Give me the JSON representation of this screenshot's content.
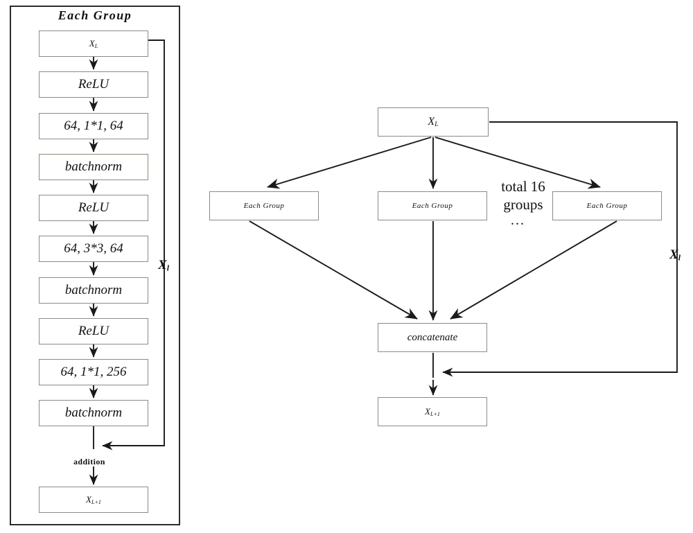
{
  "figure": {
    "title": "Each Group",
    "left_panel": {
      "title": "Each Group",
      "residual_label": "X",
      "residual_label_sub": "l",
      "addition_label": "addition",
      "nodes": [
        {
          "id": "x_l_in",
          "text": "X",
          "sub": "L",
          "style": "plain"
        },
        {
          "id": "relu_1",
          "text": "ReLU",
          "sub": "",
          "style": "plain"
        },
        {
          "id": "conv_1",
          "text": "64, 1*1, 64",
          "sub": "",
          "style": "plain"
        },
        {
          "id": "bn_1",
          "text": "batchnorm",
          "sub": "",
          "style": "tan"
        },
        {
          "id": "relu_2",
          "text": "ReLU",
          "sub": "",
          "style": "plain"
        },
        {
          "id": "conv_2",
          "text": "64, 3*3, 64",
          "sub": "",
          "style": "plain"
        },
        {
          "id": "bn_2",
          "text": "batchnorm",
          "sub": "",
          "style": "plain"
        },
        {
          "id": "relu_3",
          "text": "ReLU",
          "sub": "",
          "style": "plain"
        },
        {
          "id": "conv_3",
          "text": "64, 1*1, 256",
          "sub": "",
          "style": "plain"
        },
        {
          "id": "bn_3",
          "text": "batchnorm",
          "sub": "",
          "style": "plain"
        },
        {
          "id": "x_l_out",
          "text": "X",
          "sub": "L+1",
          "style": "plain"
        }
      ]
    },
    "right_panel": {
      "input_box": {
        "text": "X",
        "sub": "L"
      },
      "group_boxes": [
        {
          "text": "Each Group"
        },
        {
          "text": "Each Group"
        },
        {
          "text": "Each Group"
        }
      ],
      "total_line_1": "total 16",
      "total_line_2": "groups",
      "ellipsis": "...",
      "concat_box": {
        "text": "concatenate"
      },
      "output_box": {
        "text": "X",
        "sub": "L+1"
      },
      "residual_label": "X",
      "residual_label_sub": "l"
    }
  },
  "colors": {
    "panel_border": "#2b2b2b",
    "box_border": "#8a8a8a",
    "box_border_tan": "#8d8a74",
    "line": "#1a1a1a",
    "text": "#111111",
    "background": "#ffffff"
  }
}
